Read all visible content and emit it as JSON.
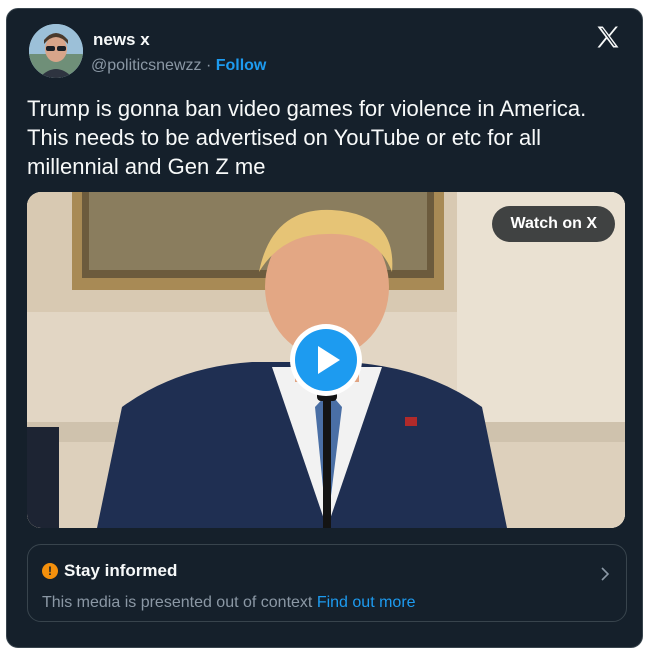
{
  "author": {
    "display_name": "news x",
    "handle": "@politicsnewzz",
    "separator": " · ",
    "follow_label": "Follow"
  },
  "tweet": {
    "text": "Trump is gonna ban video games for violence in America. This needs to be advertised on YouTube or etc for all millennial and Gen Z me"
  },
  "media": {
    "watch_label": "Watch on X"
  },
  "notice": {
    "icon": "!",
    "title": "Stay informed",
    "body": "This media is presented out of context",
    "link": "Find out more"
  },
  "icons": {
    "brand": "x-logo-icon",
    "play": "play-icon",
    "warning": "warning-icon",
    "chevron": "chevron-right-icon"
  },
  "colors": {
    "card_bg": "#15202b",
    "border": "#38444d",
    "text": "#f7f9f9",
    "muted": "#8b98a5",
    "link": "#1d9bf0",
    "warning": "#f4900c"
  }
}
